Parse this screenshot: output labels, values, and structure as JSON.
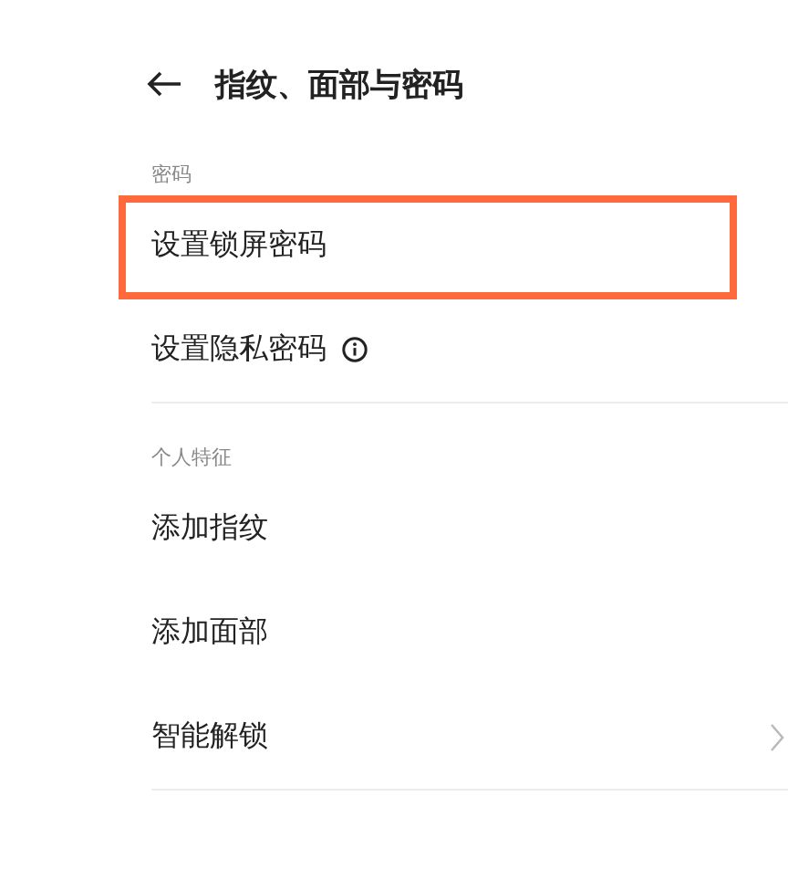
{
  "header": {
    "title": "指纹、面部与密码"
  },
  "sections": [
    {
      "label": "密码",
      "items": [
        {
          "label": "设置锁屏密码",
          "highlighted": true,
          "info": false,
          "chevron": false
        },
        {
          "label": "设置隐私密码",
          "highlighted": false,
          "info": true,
          "chevron": false
        }
      ]
    },
    {
      "label": "个人特征",
      "items": [
        {
          "label": "添加指纹",
          "highlighted": false,
          "info": false,
          "chevron": false
        },
        {
          "label": "添加面部",
          "highlighted": false,
          "info": false,
          "chevron": false
        },
        {
          "label": "智能解锁",
          "highlighted": false,
          "info": false,
          "chevron": true
        }
      ]
    }
  ]
}
